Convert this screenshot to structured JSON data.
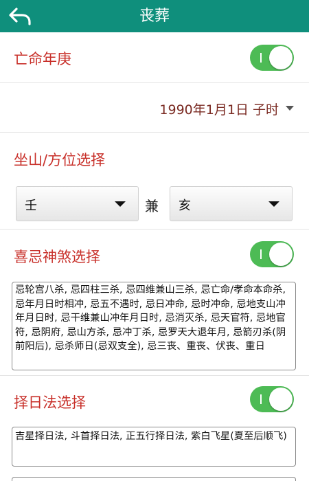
{
  "header": {
    "title": "丧葬",
    "back_icon": "back-arrow-icon"
  },
  "death_date": {
    "label": "亡命年庚",
    "toggle_on": true,
    "value": "1990年1月1日 子时"
  },
  "direction": {
    "label": "坐山/方位选择",
    "left_value": "壬",
    "connector": "兼",
    "right_value": "亥"
  },
  "taboo": {
    "label": "喜忌神煞选择",
    "toggle_on": true,
    "text": "忌轮宫八杀, 忌四柱三杀, 忌四维兼山三杀, 忌亡命/孝命本命杀, 忌年月日时相冲, 忌五不遇时, 忌日冲命, 忌时冲命, 忌地支山冲年月日时, 忌干维兼山冲年月日时, 忌消灭杀, 忌天官符, 忌地官符, 忌阴府, 忌山方杀, 忌冲丁杀, 忌罗天大退年月, 忌箭刃杀(阴前阳后), 忌杀师日(忌双支全), 忌三丧、重丧、伏丧、重日"
  },
  "method": {
    "label": "择日法选择",
    "toggle_on": true,
    "text": "吉星择日法, 斗首择日法, 正五行择日法, 紫白飞星(夏至后顺飞)"
  },
  "colors": {
    "header": "#0f8f7c",
    "section_label": "#c8302a",
    "date_text": "#7a2a22",
    "toggle_on": "#4dbb55"
  }
}
